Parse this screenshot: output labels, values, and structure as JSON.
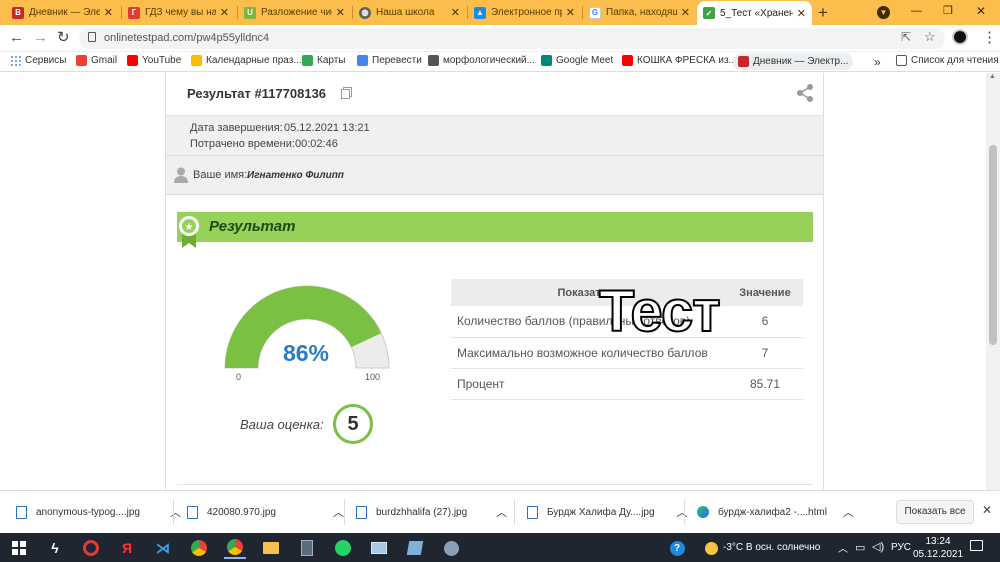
{
  "browser": {
    "tabs": [
      {
        "title": "Дневник — Элек",
        "icon_color": "#c62828",
        "icon_letter": "В"
      },
      {
        "title": "ГДЗ чему вы нау",
        "icon_color": "#e53935",
        "icon_letter": "Г"
      },
      {
        "title": "Разложение чис",
        "icon_color": "#7cb342",
        "icon_letter": "U"
      },
      {
        "title": "Наша школа",
        "icon_color": "#616161",
        "icon_letter": "◍"
      },
      {
        "title": "Электронное пр",
        "icon_color": "#1e88e5",
        "icon_letter": "▲"
      },
      {
        "title": "Папка, находящ",
        "icon_color": "#4285f4",
        "icon_letter": "G"
      },
      {
        "title": "5_Тест «Хранени",
        "icon_color": "#43a047",
        "icon_letter": "✓"
      }
    ],
    "new_tab": "+",
    "window_controls": [
      "—",
      "❐",
      "✕"
    ],
    "url": "onlinetestpad.com/pw4p55ylldnc4",
    "bookmarks": [
      {
        "label": "Сервисы",
        "color": "#4285f4"
      },
      {
        "label": "Gmail",
        "color": "#ea4335"
      },
      {
        "label": "YouTube",
        "color": "#ff0000"
      },
      {
        "label": "Календарные праз...",
        "color": "#fbbc05"
      },
      {
        "label": "Карты",
        "color": "#34a853"
      },
      {
        "label": "Перевести",
        "color": "#4285f4"
      },
      {
        "label": "морфологический...",
        "color": "#555555"
      },
      {
        "label": "Google Meet",
        "color": "#00897b"
      },
      {
        "label": "КОШКА ФРЕСКА из...",
        "color": "#ff0000"
      },
      {
        "label": "Дневник — Электр...",
        "color": "#c62828"
      }
    ],
    "reading_list": "Список для чтения"
  },
  "result": {
    "title": "Результат #117708136",
    "completed_label": "Дата завершения:",
    "completed_value": "05.12.2021 13:21",
    "time_label": "Потрачено времени:",
    "time_value": "00:02:46",
    "name_label": "Ваше имя:",
    "name_value": "Игнатенко Филипп",
    "banner": "Результат",
    "gauge_percent": "86%",
    "gauge_fraction": 0.86,
    "gauge_min": "0",
    "gauge_max": "100",
    "grade_label": "Ваша оценка:",
    "grade_value": "5",
    "table_header_indicator": "Показатели",
    "table_header_value": "Значение",
    "rows": [
      {
        "label": "Количество баллов (правильных ответов)",
        "value": "6"
      },
      {
        "label": "Максимально возможное количество баллов",
        "value": "7"
      },
      {
        "label": "Процент",
        "value": "85.71"
      }
    ],
    "overlay_text": "Тест",
    "accent_color": "#8bd04a",
    "gauge_color": "#7ac043",
    "percent_color": "#2b7bc3"
  },
  "downloads": {
    "items": [
      "anonymous-typog....jpg",
      "420080.970.jpg",
      "burdzhhalifa (27).jpg",
      "Бурдж Халифа Ду....jpg",
      "бурдж-халифа2 -....html"
    ],
    "show_all": "Показать все"
  },
  "taskbar": {
    "weather": "-3°C  В осн. солнечно",
    "lang": "РУС",
    "time": "13:24",
    "date": "05.12.2021"
  }
}
